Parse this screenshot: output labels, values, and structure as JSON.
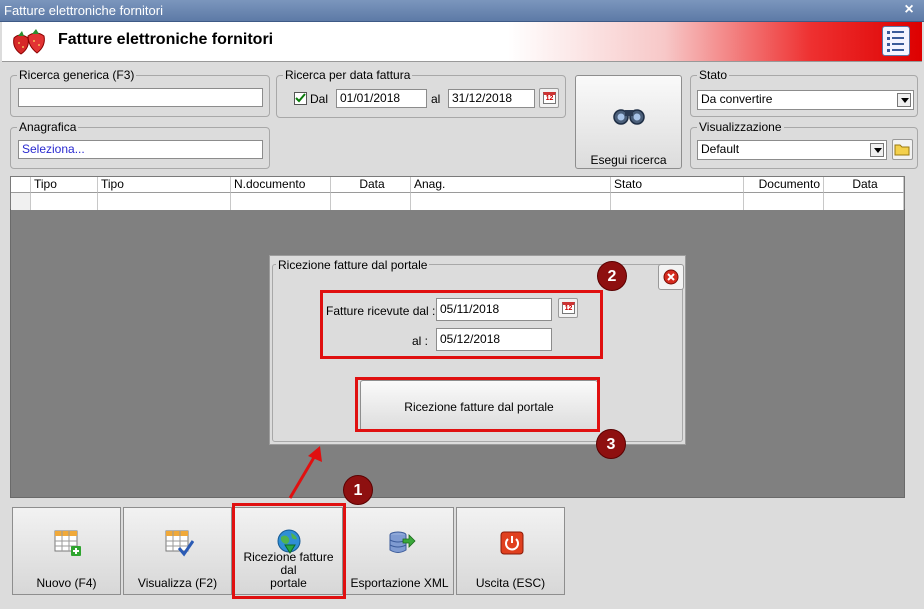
{
  "window": {
    "title": "Fatture elettroniche fornitori",
    "close_symbol": "×"
  },
  "header": {
    "title": "Fatture elettroniche fornitori"
  },
  "ricerca_generica": {
    "label": "Ricerca generica (F3)",
    "value": ""
  },
  "ricerca_data": {
    "label": "Ricerca per data fattura",
    "dal_label": "Dal",
    "dal_checked": true,
    "dal_value": "01/01/2018",
    "al_label": "al",
    "al_value": "31/12/2018",
    "calendar_text": "12"
  },
  "anagrafica": {
    "label": "Anagrafica",
    "value": "Seleziona..."
  },
  "esegui_ricerca": {
    "label": "Esegui ricerca"
  },
  "stato": {
    "label": "Stato",
    "value": "Da convertire"
  },
  "visualizzazione": {
    "label": "Visualizzazione",
    "value": "Default"
  },
  "table": {
    "columns": [
      "Tipo",
      "Tipo",
      "N.documento",
      "Data",
      "Anag.",
      "Stato",
      "Documento",
      "Data"
    ]
  },
  "dialog": {
    "title": "Ricezione fatture dal portale",
    "from_label": "Fatture ricevute dal :",
    "from_value": "05/11/2018",
    "to_label": "al :",
    "to_value": "05/12/2018",
    "action_label": "Ricezione fatture dal portale",
    "calendar_text": "12"
  },
  "annotations": {
    "badge_1": "1",
    "badge_2": "2",
    "badge_3": "3"
  },
  "buttons": {
    "nuovo": "Nuovo (F4)",
    "visualizza": "Visualizza (F2)",
    "ricezione_line1": "Ricezione fatture dal",
    "ricezione_line2": "portale",
    "esportazione": "Esportazione XML",
    "uscita": "Uscita (ESC)"
  },
  "colors": {
    "annotation_red": "#e01010",
    "badge_red": "#8e1010",
    "title_blue": "#5d7aa6"
  }
}
